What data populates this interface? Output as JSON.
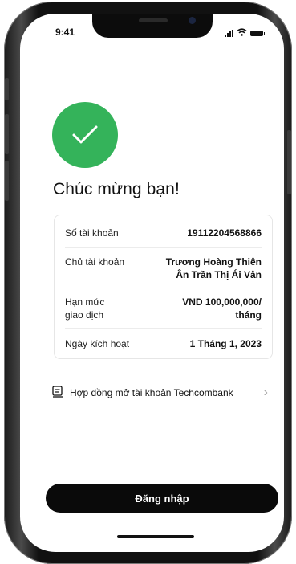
{
  "status_bar": {
    "time": "9:41"
  },
  "success": {
    "title": "Chúc mừng bạn!"
  },
  "account_details": [
    {
      "label": "Số tài khoản",
      "value": "19112204568866"
    },
    {
      "label": "Chủ tài khoản",
      "value_lines": [
        "Trương Hoàng Thiên",
        "Ân Trần Thị Ái Vân"
      ]
    },
    {
      "label_lines": [
        "Hạn mức",
        "giao dịch"
      ],
      "value_lines": [
        "VND 100,000,000/",
        "tháng"
      ]
    },
    {
      "label": "Ngày kích hoạt",
      "value": "1 Tháng 1, 2023"
    }
  ],
  "contract": {
    "label": "Hợp đồng mở tài khoản Techcombank",
    "icon": "document-icon"
  },
  "login_button": {
    "label": "Đăng nhập"
  },
  "colors": {
    "success_green": "#34b35a",
    "button_black": "#0a0a0a"
  }
}
